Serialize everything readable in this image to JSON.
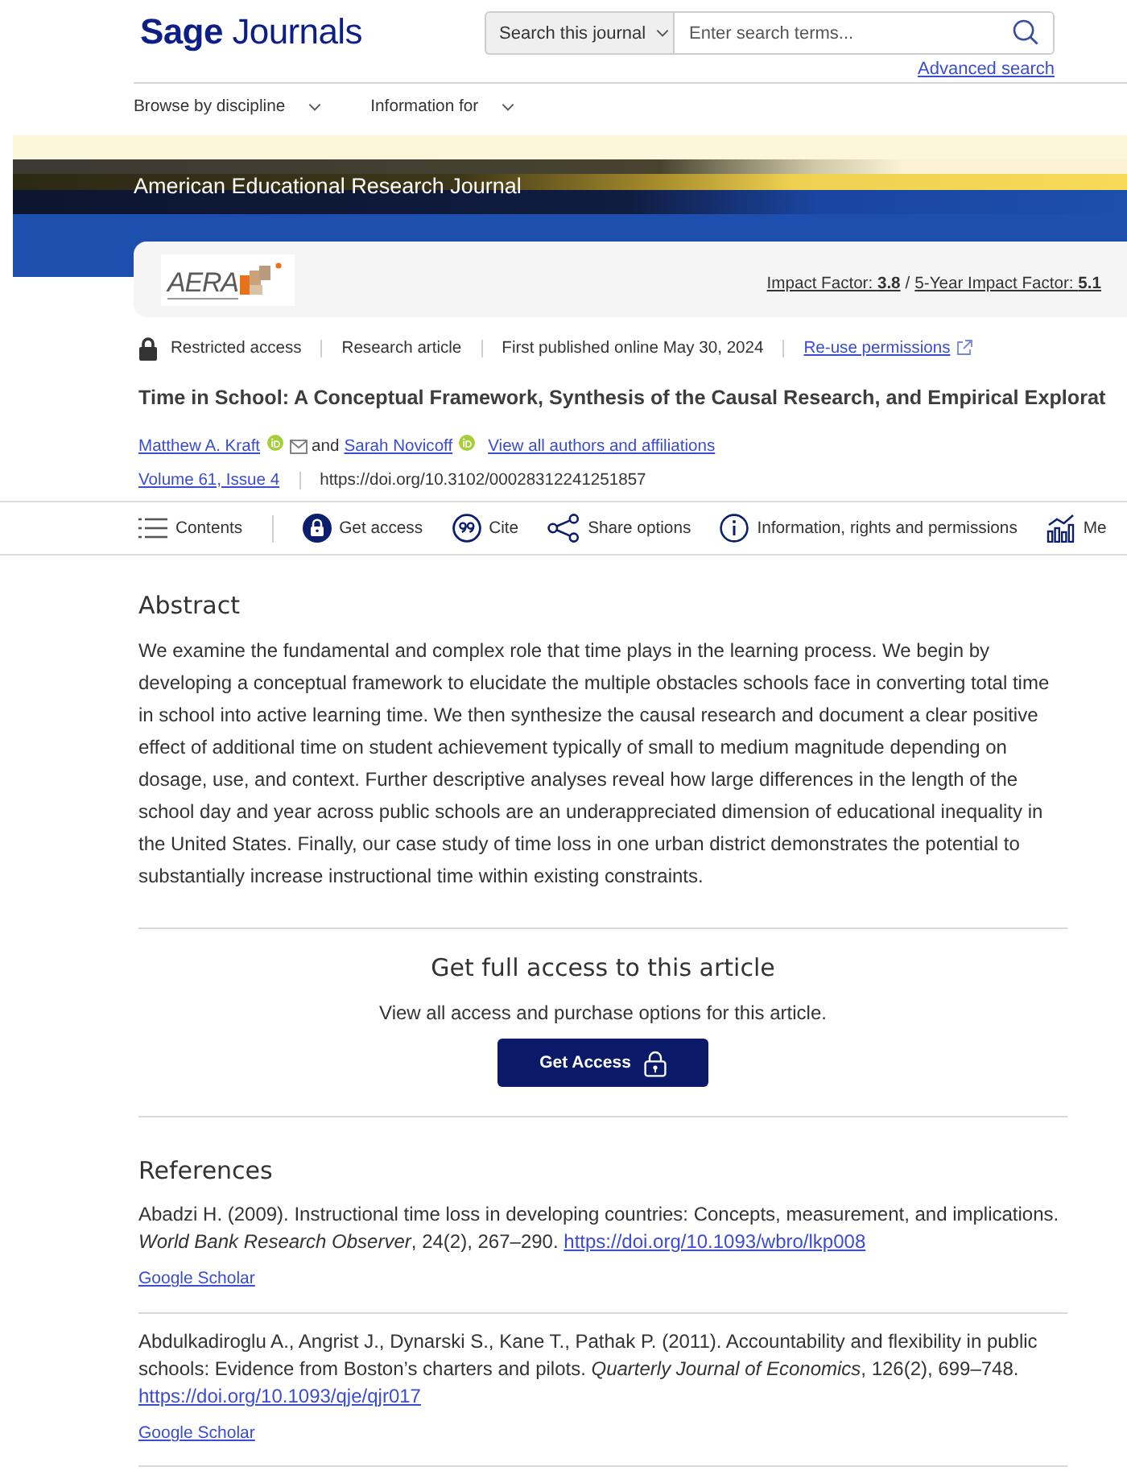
{
  "header": {
    "logo": "**Sage** Journals",
    "search": {
      "scope": "Search this journal",
      "placeholder": "Enter search terms..."
    },
    "advanced_search": "Advanced search"
  },
  "nav": [
    {
      "label": "Browse by discipline"
    },
    {
      "label": "Information for"
    }
  ],
  "banner": {
    "journal_title": "American Educational Research Journal"
  },
  "journal_card": {
    "logo": {
      "wordmark": "AERA"
    },
    "metrics": [
      "Impact Factor: **3.8**",
      "5-Year Impact Factor: **5.1**"
    ],
    "separator": "/"
  },
  "meta": [
    {
      "kind": "access",
      "label": "Restricted access"
    },
    {
      "kind": "text",
      "label": "Research article"
    },
    {
      "kind": "text",
      "label": "First published online May 30, 2024"
    },
    {
      "kind": "link",
      "label": "Re-use permissions"
    }
  ],
  "article": {
    "title": "Time in School: A Conceptual Framework, Synthesis of the Causal Research, and Empirical Explorat",
    "authors": [
      {
        "name": "Matthew A. Kraft",
        "orcid": true,
        "email": true
      },
      {
        "name": "Sarah Novicoff",
        "orcid": true,
        "email": false
      }
    ],
    "joiner": "and",
    "all_authors": "View all authors and affiliations",
    "issue": "Volume 61, Issue 4",
    "doi": "https://doi.org/10.3102/00028312241251857"
  },
  "toolbar": [
    {
      "kind": "contents",
      "label": "Contents"
    },
    {
      "kind": "access",
      "label": "Get access"
    },
    {
      "kind": "cite",
      "label": "Cite"
    },
    {
      "kind": "share",
      "label": "Share options"
    },
    {
      "kind": "info",
      "label": "Information, rights and permissions"
    },
    {
      "kind": "metrics",
      "label": "Me"
    }
  ],
  "abstract": {
    "heading": "Abstract",
    "text": "We examine the fundamental and complex role that time plays in the learning process. We begin by developing a conceptual framework to elucidate the multiple obstacles schools face in converting total time in school into active learning time. We then synthesize the causal research and document a clear positive effect of additional time on student achievement typically of small to medium magnitude depending on dosage, use, and context. Further descriptive analyses reveal how large differences in the length of the school day and year across public schools are an underappreciated dimension of educational inequality in the United States. Finally, our case study of time loss in one urban district demonstrates the potential to substantially increase instructional time within existing constraints."
  },
  "access_box": {
    "heading": "Get full access to this article",
    "text": "View all access and purchase options for this article.",
    "button": "Get Access"
  },
  "references": {
    "heading": "References",
    "items": [
      {
        "text": "Abadzi H. (2009). Instructional time loss in developing countries: Concepts, measurement, and implications. *World Bank Research Observer*, 24(2), 267–290.",
        "doi": "https://doi.org/10.1093/wbro/lkp008",
        "scholar": "Google Scholar"
      },
      {
        "text": "Abdulkadiroglu A., Angrist J., Dynarski S., Kane T., Pathak P. (2011). Accountability and flexibility in public schools: Evidence from Boston’s charters and pilots. *Quarterly Journal of Economics*, 126(2), 699–748.",
        "doi": "https://doi.org/10.1093/qje/qjr017",
        "scholar": "Google Scholar"
      }
    ]
  }
}
